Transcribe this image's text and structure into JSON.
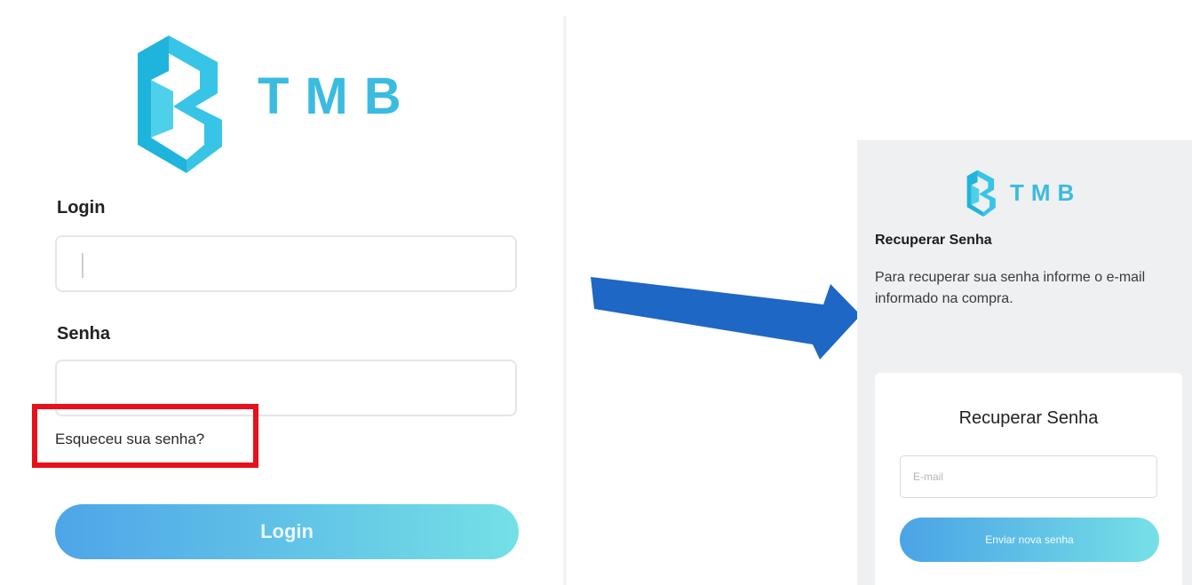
{
  "brand": {
    "name": "TMB",
    "accent": "#3bbbe0"
  },
  "login_screen": {
    "login_label": "Login",
    "login_value": "",
    "senha_label": "Senha",
    "senha_value": "",
    "forgot_link": "Esqueceu sua senha?",
    "login_button": "Login",
    "highlight_color": "#e8101a"
  },
  "arrow": {
    "icon": "arrow-right-icon",
    "color": "#1e67c4"
  },
  "recover_screen": {
    "title": "Recuperar Senha",
    "description": "Para recuperar sua senha informe o e-mail informado na compra.",
    "card_title": "Recuperar Senha",
    "email_placeholder": "E-mail",
    "send_button": "Enviar nova senha"
  }
}
